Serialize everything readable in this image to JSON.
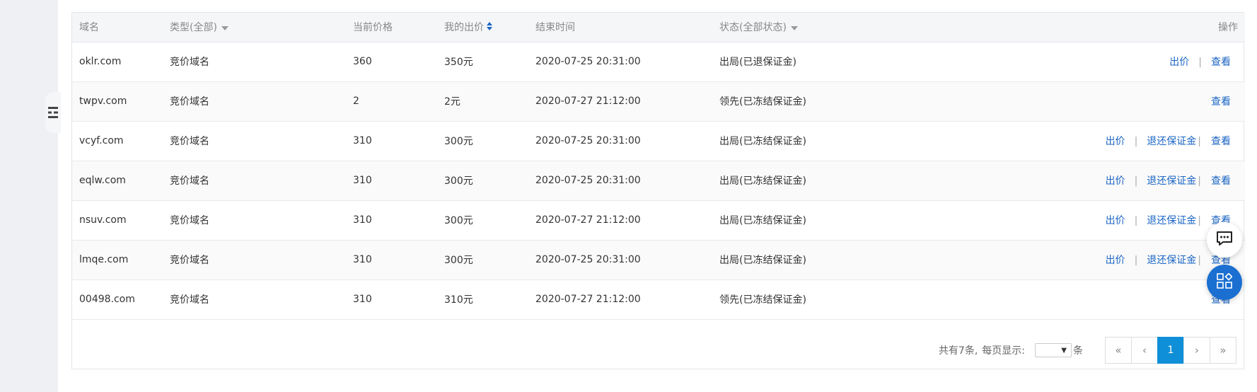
{
  "table": {
    "headers": {
      "domain": "域名",
      "type": "类型(全部)",
      "current_price": "当前价格",
      "my_bid": "我的出价",
      "end_time": "结束时间",
      "status": "状态(全部状态)",
      "actions": "操作"
    },
    "rows": [
      {
        "domain": "oklr.com",
        "type": "竞价域名",
        "current_price": "360",
        "my_bid": "350元",
        "end_time": "2020-07-25 20:31:00",
        "status": "出局(已退保证金)",
        "actions": [
          "出价",
          "查看"
        ]
      },
      {
        "domain": "twpv.com",
        "type": "竞价域名",
        "current_price": "2",
        "my_bid": "2元",
        "end_time": "2020-07-27 21:12:00",
        "status": "领先(已冻结保证金)",
        "actions": [
          "查看"
        ]
      },
      {
        "domain": "vcyf.com",
        "type": "竞价域名",
        "current_price": "310",
        "my_bid": "300元",
        "end_time": "2020-07-25 20:31:00",
        "status": "出局(已冻结保证金)",
        "actions": [
          "出价",
          "退还保证金",
          "查看"
        ]
      },
      {
        "domain": "eqlw.com",
        "type": "竞价域名",
        "current_price": "310",
        "my_bid": "300元",
        "end_time": "2020-07-25 20:31:00",
        "status": "出局(已冻结保证金)",
        "actions": [
          "出价",
          "退还保证金",
          "查看"
        ]
      },
      {
        "domain": "nsuv.com",
        "type": "竞价域名",
        "current_price": "310",
        "my_bid": "300元",
        "end_time": "2020-07-27 21:12:00",
        "status": "出局(已冻结保证金)",
        "actions": [
          "出价",
          "退还保证金",
          "查看"
        ]
      },
      {
        "domain": "lmqe.com",
        "type": "竞价域名",
        "current_price": "310",
        "my_bid": "300元",
        "end_time": "2020-07-25 20:31:00",
        "status": "出局(已冻结保证金)",
        "actions": [
          "出价",
          "退还保证金",
          "查看"
        ]
      },
      {
        "domain": "00498.com",
        "type": "竞价域名",
        "current_price": "310",
        "my_bid": "310元",
        "end_time": "2020-07-27 21:12:00",
        "status": "领先(已冻结保证金)",
        "actions": [
          "查看"
        ]
      }
    ]
  },
  "pager": {
    "total_text": "共有7条,",
    "per_page_label": "每页显示:",
    "per_page_value": "",
    "unit": "条",
    "first": "«",
    "prev": "‹",
    "current": "1",
    "next": "›",
    "last": "»"
  },
  "icons": {
    "collapse": "menu-collapse-icon",
    "chat": "chat-bubble-icon",
    "apps": "apps-grid-icon"
  },
  "colors": {
    "link": "#1a65c4",
    "active_page": "#0f8fd8",
    "float_apps": "#1a6fd1"
  }
}
